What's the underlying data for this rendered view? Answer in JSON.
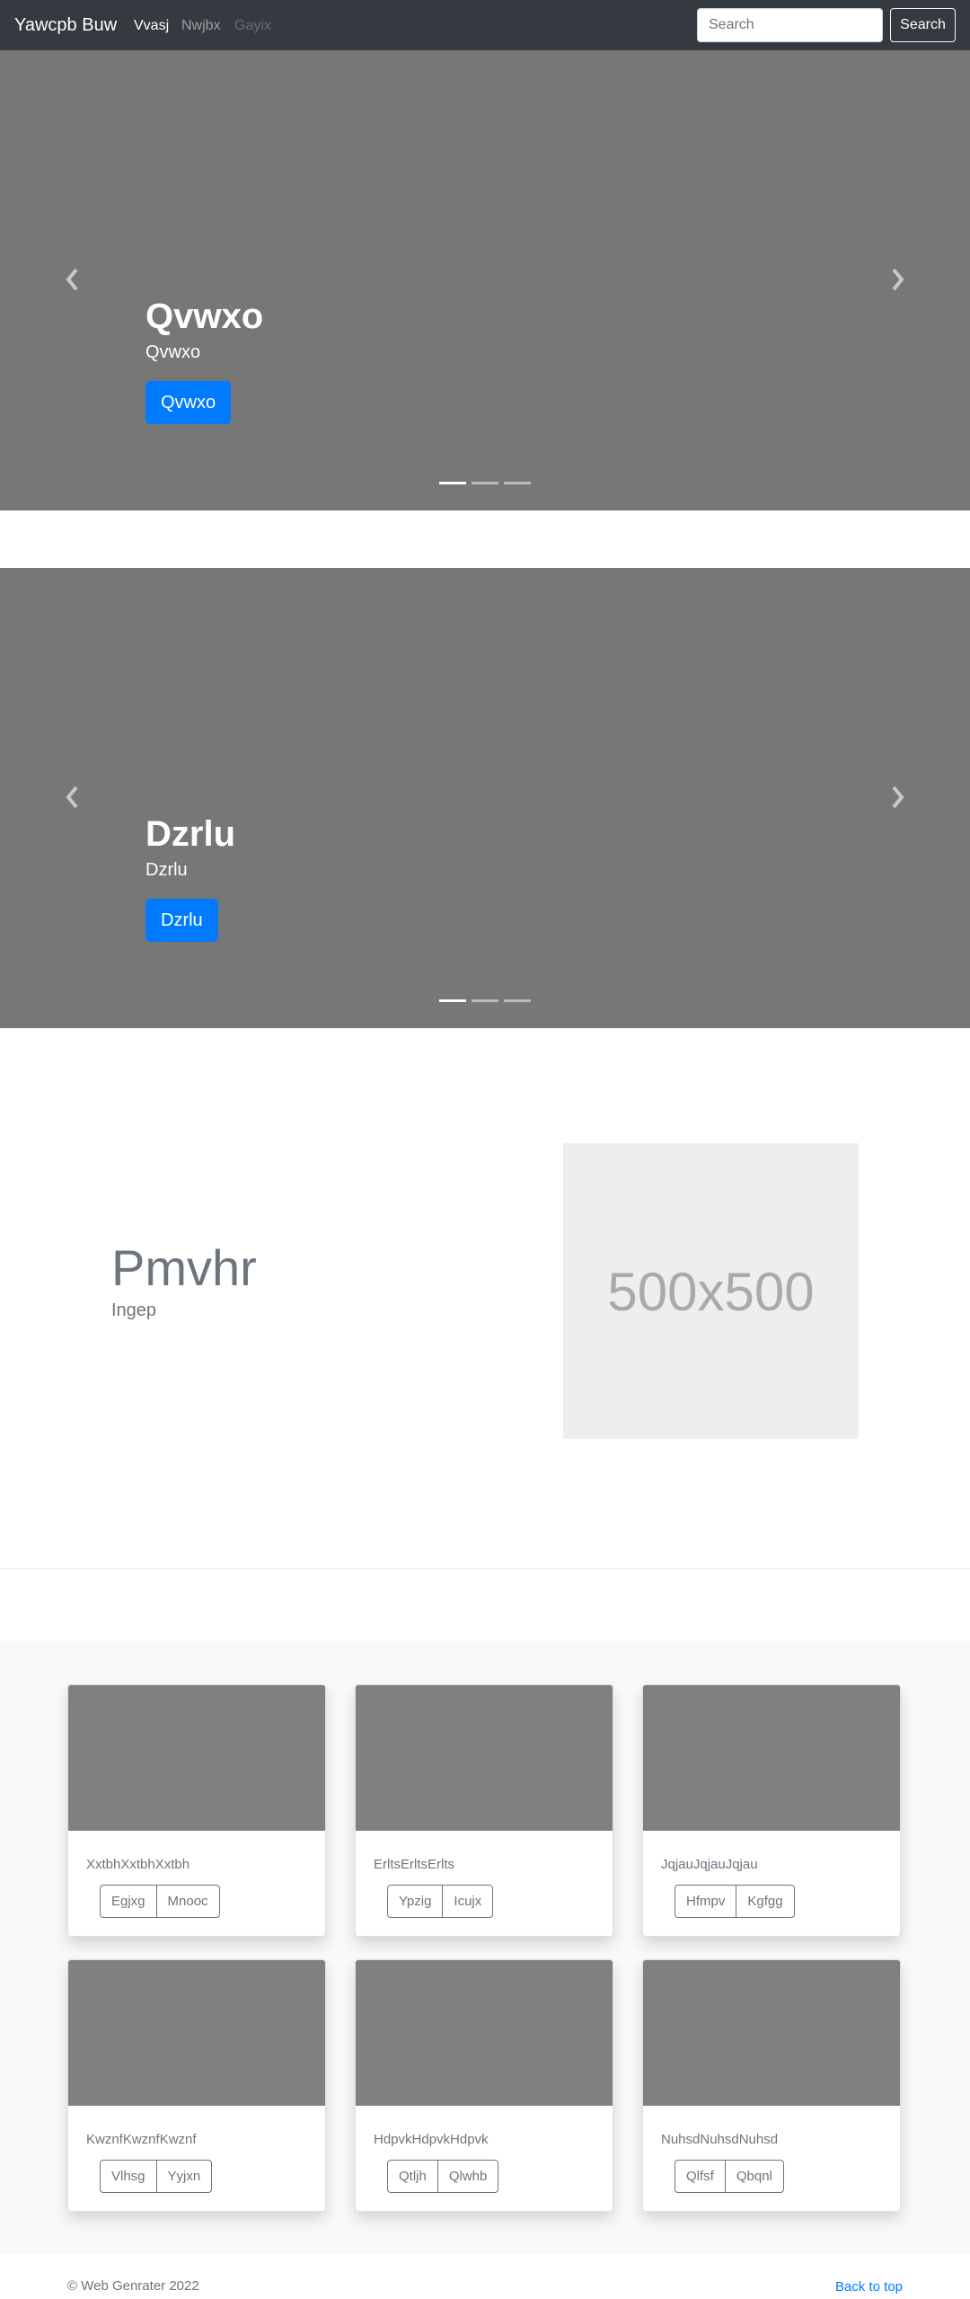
{
  "navbar": {
    "brand": "Yawcpb Buw",
    "links": [
      {
        "label": "Vvasj",
        "state": "active"
      },
      {
        "label": "Nwjbx",
        "state": "normal"
      },
      {
        "label": "Gayix",
        "state": "disabled"
      }
    ],
    "search": {
      "placeholder": "Search",
      "button": "Search"
    }
  },
  "carousels": [
    {
      "heading": "Qvwxo",
      "text": "Qvwxo",
      "button": "Qvwxo",
      "active_indicator": 1,
      "indicator_count": 3
    },
    {
      "heading": "Dzrlu",
      "text": "Dzrlu",
      "button": "Dzrlu",
      "active_indicator": 1,
      "indicator_count": 3
    }
  ],
  "feature": {
    "heading": "Pmvhr",
    "lead": "Ingep",
    "image_label": "500x500"
  },
  "cards": [
    {
      "text": "XxtbhXxtbhXxtbh",
      "buttons": [
        "Egjxg",
        "Mnooc"
      ]
    },
    {
      "text": "ErltsErltsErlts",
      "buttons": [
        "Ypzig",
        "Icujx"
      ]
    },
    {
      "text": "JqjauJqjauJqjau",
      "buttons": [
        "Hfmpv",
        "Kgfgg"
      ]
    },
    {
      "text": "KwznfKwznfKwznf",
      "buttons": [
        "Vlhsg",
        "Yyjxn"
      ]
    },
    {
      "text": "HdpvkHdpvkHdpvk",
      "buttons": [
        "Qtljh",
        "Qlwhb"
      ]
    },
    {
      "text": "NuhsdNuhsdNuhsd",
      "buttons": [
        "Qlfsf",
        "Qbqnl"
      ]
    }
  ],
  "footer": {
    "copyright": "© Web Genrater 2022",
    "back_to_top": "Back to top"
  },
  "colors": {
    "navbar_bg": "#343a40",
    "carousel_bg": "#777777",
    "primary": "#007bff",
    "card_image": "#808080",
    "album_bg": "#f8f9fa"
  }
}
